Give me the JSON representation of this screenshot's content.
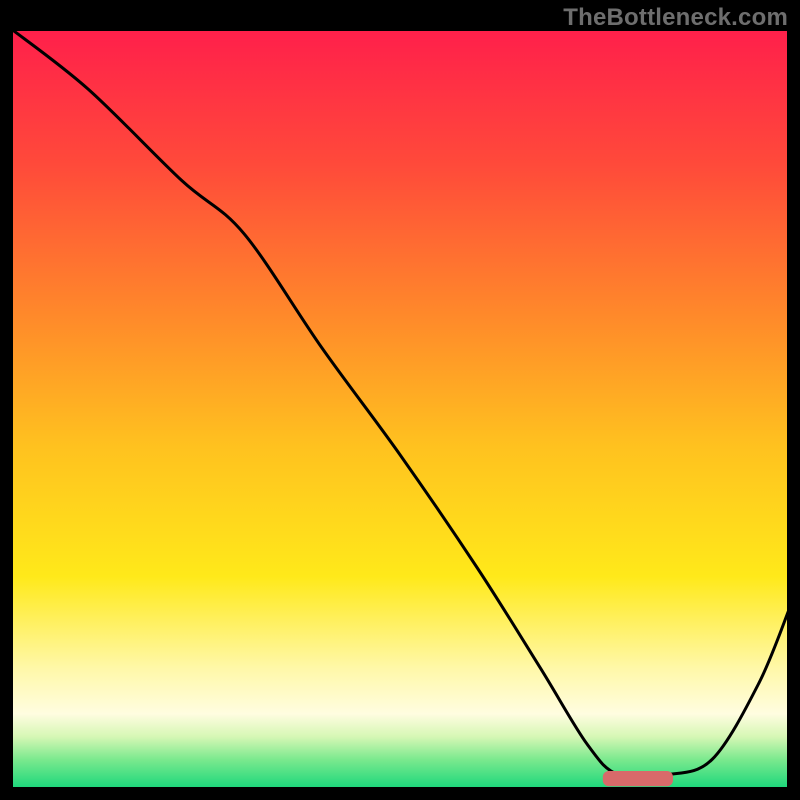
{
  "watermark": "TheBottleneck.com",
  "chart_data": {
    "type": "line",
    "title": "",
    "xlabel": "",
    "ylabel": "",
    "xlim": [
      0,
      100
    ],
    "ylim": [
      0,
      100
    ],
    "grid": false,
    "legend": false,
    "background_gradient_stops": [
      {
        "offset": 0.0,
        "color": "#ff1f4b"
      },
      {
        "offset": 0.18,
        "color": "#ff4a3a"
      },
      {
        "offset": 0.38,
        "color": "#ff8a2a"
      },
      {
        "offset": 0.55,
        "color": "#ffc21f"
      },
      {
        "offset": 0.72,
        "color": "#ffe91a"
      },
      {
        "offset": 0.84,
        "color": "#fff8a8"
      },
      {
        "offset": 0.9,
        "color": "#fffde0"
      },
      {
        "offset": 0.93,
        "color": "#d6f7b5"
      },
      {
        "offset": 0.96,
        "color": "#7be98e"
      },
      {
        "offset": 1.0,
        "color": "#15d67a"
      }
    ],
    "series": [
      {
        "name": "bottleneck-curve",
        "color": "#000000",
        "x": [
          0,
          10,
          22,
          30,
          40,
          50,
          60,
          68,
          74,
          78,
          84,
          90,
          96,
          100
        ],
        "y": [
          100,
          92,
          80,
          73,
          58,
          44,
          29,
          16,
          6,
          2,
          2,
          4,
          14,
          24
        ]
      }
    ],
    "marker": {
      "name": "optimal-range",
      "color": "#d86a6a",
      "x_start": 76,
      "x_end": 85,
      "y": 1.5,
      "thickness_pct": 2.0
    }
  }
}
